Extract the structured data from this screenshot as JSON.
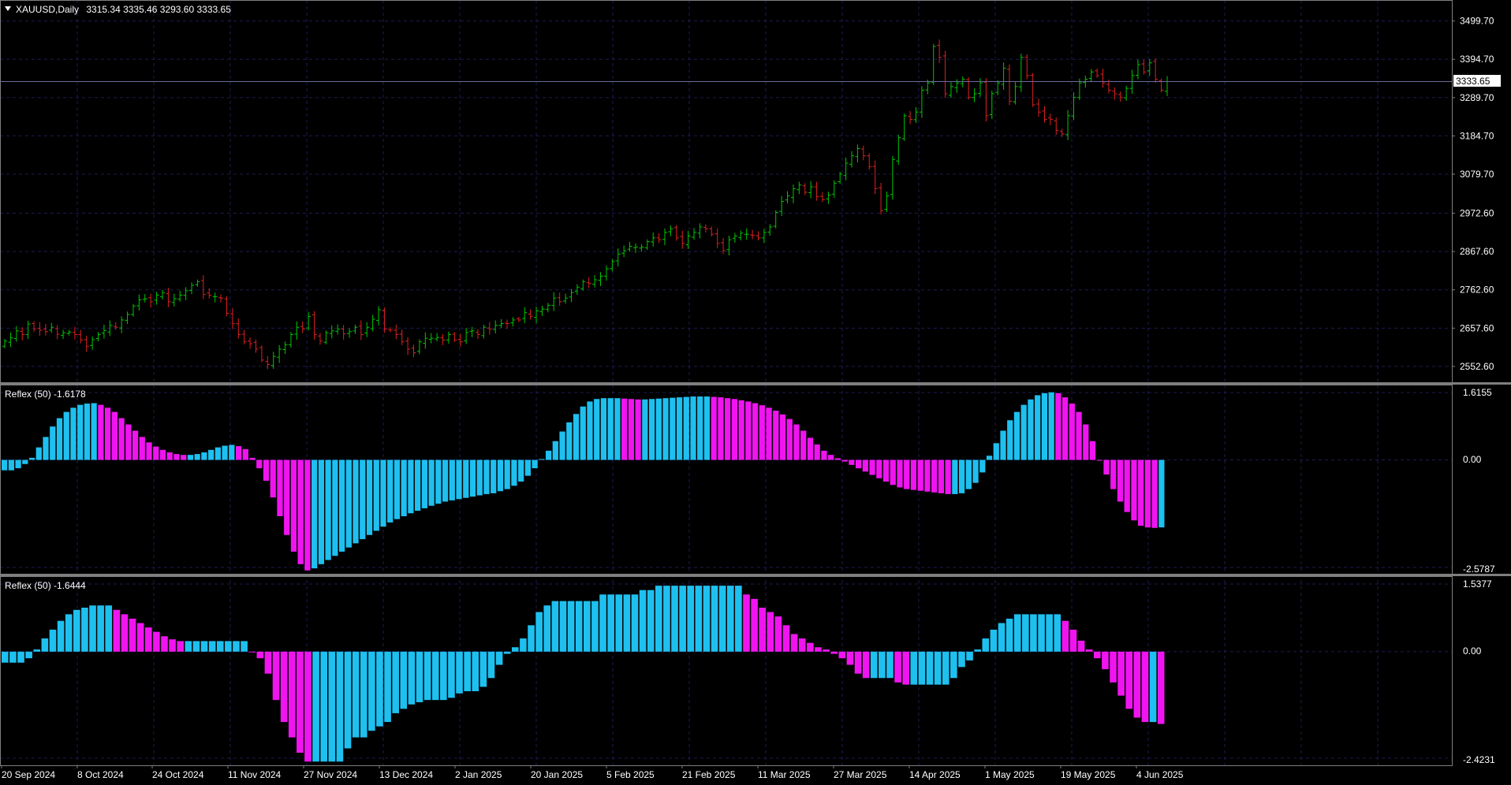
{
  "main": {
    "symbol": "XAUUSD,Daily",
    "ohlc": "3315.34 3335.46 3293.60 3333.65",
    "current_price": "3333.65",
    "price_labels": [
      "3499.70",
      "3394.70",
      "3289.70",
      "3184.70",
      "3079.70",
      "2972.60",
      "2867.60",
      "2762.60",
      "2657.60",
      "2552.60"
    ],
    "up_color": "#00c800",
    "down_color": "#e02020"
  },
  "indicator1": {
    "title": "Reflex (50) -1.6178",
    "max_label": "1.6155",
    "zero_label": "0.00",
    "min_label": "-2.5787"
  },
  "indicator2": {
    "title": "Reflex (50) -1.6444",
    "max_label": "1.5377",
    "zero_label": "0.00",
    "min_label": "-2.4231"
  },
  "time_axis": {
    "labels": [
      "20 Sep 2024",
      "8 Oct 2024",
      "24 Oct 2024",
      "11 Nov 2024",
      "27 Nov 2024",
      "13 Dec 2024",
      "2 Jan 2025",
      "20 Jan 2025",
      "5 Feb 2025",
      "21 Feb 2025",
      "11 Mar 2025",
      "27 Mar 2025",
      "14 Apr 2025",
      "1 May 2025",
      "19 May 2025",
      "4 Jun 2025"
    ]
  },
  "colors": {
    "bull_histogram": "#1ec0f0",
    "bear_histogram": "#f014f0",
    "grid": "#1c1c54"
  },
  "chart_data": [
    {
      "type": "candlestick",
      "title": "XAUUSD,Daily",
      "xlabel": "",
      "ylabel": "",
      "ylim": [
        2520,
        3540
      ],
      "x_start": "20 Sep 2024",
      "x_end": "4 Jun 2025",
      "close": [
        2622,
        2631,
        2650,
        2640,
        2669,
        2655,
        2652,
        2648,
        2660,
        2641,
        2645,
        2647,
        2640,
        2625,
        2608,
        2626,
        2640,
        2651,
        2665,
        2660,
        2680,
        2695,
        2718,
        2735,
        2738,
        2730,
        2748,
        2755,
        2730,
        2738,
        2748,
        2760,
        2775,
        2785,
        2750,
        2748,
        2744,
        2740,
        2698,
        2670,
        2640,
        2620,
        2615,
        2600,
        2570,
        2558,
        2580,
        2600,
        2612,
        2640,
        2660,
        2655,
        2690,
        2640,
        2622,
        2645,
        2650,
        2655,
        2642,
        2648,
        2660,
        2640,
        2660,
        2682,
        2708,
        2655,
        2652,
        2640,
        2620,
        2600,
        2590,
        2620,
        2630,
        2630,
        2632,
        2625,
        2640,
        2625,
        2620,
        2645,
        2650,
        2640,
        2660,
        2655,
        2665,
        2670,
        2670,
        2680,
        2680,
        2700,
        2690,
        2705,
        2710,
        2720,
        2740,
        2730,
        2740,
        2755,
        2770,
        2785,
        2780,
        2790,
        2800,
        2820,
        2840,
        2860,
        2870,
        2882,
        2880,
        2880,
        2895,
        2905,
        2900,
        2920,
        2930,
        2905,
        2890,
        2910,
        2920,
        2935,
        2930,
        2915,
        2890,
        2870,
        2900,
        2910,
        2918,
        2915,
        2912,
        2905,
        2920,
        2935,
        2975,
        3005,
        3020,
        3040,
        3050,
        3030,
        3045,
        3018,
        3010,
        3022,
        3055,
        3080,
        3110,
        3130,
        3150,
        3130,
        3100,
        3040,
        2980,
        3020,
        3120,
        3180,
        3240,
        3230,
        3250,
        3310,
        3330,
        3430,
        3400,
        3300,
        3320,
        3330,
        3340,
        3290,
        3300,
        3330,
        3240,
        3300,
        3330,
        3370,
        3280,
        3320,
        3400,
        3350,
        3270,
        3250,
        3230,
        3230,
        3200,
        3190,
        3240,
        3290,
        3330,
        3340,
        3360,
        3350,
        3330,
        3310,
        3300,
        3290,
        3315,
        3350,
        3380,
        3360,
        3385,
        3340,
        3310,
        3333.65
      ]
    },
    {
      "type": "bar",
      "title": "Reflex (50) -1.6178",
      "xlabel": "",
      "ylabel": "",
      "ylim": [
        -2.5787,
        1.6155
      ],
      "color_rule": "cyan while rising, magenta while falling",
      "values": [
        -0.25,
        -0.25,
        -0.2,
        -0.1,
        0.05,
        0.3,
        0.55,
        0.8,
        1.0,
        1.15,
        1.25,
        1.32,
        1.35,
        1.36,
        1.32,
        1.25,
        1.15,
        1.0,
        0.85,
        0.7,
        0.55,
        0.42,
        0.32,
        0.24,
        0.18,
        0.14,
        0.12,
        0.12,
        0.14,
        0.18,
        0.24,
        0.3,
        0.34,
        0.36,
        0.33,
        0.26,
        0.05,
        -0.2,
        -0.5,
        -0.9,
        -1.35,
        -1.8,
        -2.2,
        -2.5,
        -2.65,
        -2.6,
        -2.5,
        -2.4,
        -2.3,
        -2.2,
        -2.1,
        -2.0,
        -1.9,
        -1.8,
        -1.7,
        -1.6,
        -1.5,
        -1.42,
        -1.35,
        -1.28,
        -1.22,
        -1.16,
        -1.1,
        -1.05,
        -1.0,
        -0.97,
        -0.94,
        -0.91,
        -0.88,
        -0.85,
        -0.82,
        -0.8,
        -0.75,
        -0.7,
        -0.62,
        -0.52,
        -0.38,
        -0.2,
        0.02,
        0.22,
        0.45,
        0.68,
        0.9,
        1.1,
        1.28,
        1.4,
        1.46,
        1.48,
        1.48,
        1.48,
        1.47,
        1.46,
        1.45,
        1.45,
        1.46,
        1.47,
        1.48,
        1.49,
        1.5,
        1.51,
        1.52,
        1.52,
        1.52,
        1.51,
        1.5,
        1.48,
        1.46,
        1.43,
        1.4,
        1.36,
        1.31,
        1.25,
        1.18,
        1.09,
        0.98,
        0.85,
        0.7,
        0.53,
        0.37,
        0.22,
        0.12,
        0.04,
        -0.04,
        -0.12,
        -0.2,
        -0.28,
        -0.36,
        -0.44,
        -0.52,
        -0.6,
        -0.66,
        -0.7,
        -0.72,
        -0.74,
        -0.76,
        -0.78,
        -0.8,
        -0.82,
        -0.82,
        -0.8,
        -0.7,
        -0.55,
        -0.3,
        0.1,
        0.4,
        0.7,
        0.95,
        1.15,
        1.32,
        1.45,
        1.55,
        1.6,
        1.62,
        1.6,
        1.5,
        1.35,
        1.15,
        0.85,
        0.45,
        0.0,
        -0.35,
        -0.7,
        -1.0,
        -1.25,
        -1.45,
        -1.58,
        -1.62,
        -1.63,
        -1.6178
      ]
    },
    {
      "type": "bar",
      "title": "Reflex (50) -1.6444",
      "xlabel": "",
      "ylabel": "",
      "ylim": [
        -2.4231,
        1.5377
      ],
      "color_rule": "cyan while rising, magenta while falling",
      "values": [
        -0.25,
        -0.25,
        -0.25,
        -0.15,
        0.05,
        0.3,
        0.5,
        0.7,
        0.85,
        0.95,
        1.0,
        1.05,
        1.05,
        1.05,
        0.95,
        0.85,
        0.75,
        0.65,
        0.55,
        0.45,
        0.35,
        0.28,
        0.24,
        0.24,
        0.24,
        0.24,
        0.24,
        0.24,
        0.24,
        0.24,
        0.24,
        0.0,
        -0.15,
        -0.5,
        -1.1,
        -1.6,
        -1.95,
        -2.3,
        -2.5,
        -2.5,
        -2.5,
        -2.5,
        -2.5,
        -2.2,
        -1.95,
        -1.95,
        -1.8,
        -1.7,
        -1.6,
        -1.4,
        -1.3,
        -1.2,
        -1.15,
        -1.1,
        -1.1,
        -1.1,
        -1.05,
        -0.95,
        -0.9,
        -0.9,
        -0.8,
        -0.6,
        -0.3,
        -0.05,
        0.1,
        0.3,
        0.6,
        0.9,
        1.05,
        1.15,
        1.15,
        1.15,
        1.15,
        1.15,
        1.15,
        1.3,
        1.3,
        1.3,
        1.3,
        1.3,
        1.4,
        1.4,
        1.5,
        1.5,
        1.5,
        1.5,
        1.5,
        1.5,
        1.5,
        1.5,
        1.5,
        1.5,
        1.5,
        1.3,
        1.2,
        1.0,
        0.9,
        0.8,
        0.6,
        0.4,
        0.3,
        0.2,
        0.1,
        0.05,
        -0.05,
        -0.15,
        -0.3,
        -0.5,
        -0.6,
        -0.6,
        -0.6,
        -0.6,
        -0.7,
        -0.75,
        -0.75,
        -0.75,
        -0.75,
        -0.75,
        -0.75,
        -0.6,
        -0.35,
        -0.2,
        0.05,
        0.3,
        0.5,
        0.65,
        0.75,
        0.85,
        0.85,
        0.85,
        0.85,
        0.85,
        0.85,
        0.7,
        0.5,
        0.25,
        0.05,
        -0.15,
        -0.4,
        -0.7,
        -1.0,
        -1.3,
        -1.5,
        -1.6,
        -1.6,
        -1.6444
      ]
    }
  ]
}
